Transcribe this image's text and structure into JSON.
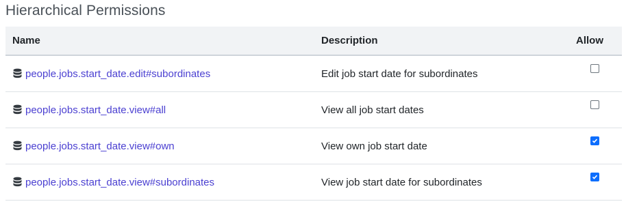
{
  "section": {
    "title": "Hierarchical Permissions"
  },
  "table": {
    "headers": {
      "name": "Name",
      "description": "Description",
      "allow": "Allow"
    },
    "rows": [
      {
        "icon": "database-icon",
        "name": "people.jobs.start_date.edit#subordinates",
        "description": "Edit job start date for subordinates",
        "allowed": false
      },
      {
        "icon": "database-icon",
        "name": "people.jobs.start_date.view#all",
        "description": "View all job start dates",
        "allowed": false
      },
      {
        "icon": "database-icon",
        "name": "people.jobs.start_date.view#own",
        "description": "View own job start date",
        "allowed": true
      },
      {
        "icon": "database-icon",
        "name": "people.jobs.start_date.view#subordinates",
        "description": "View job start date for subordinates",
        "allowed": true
      }
    ]
  },
  "colors": {
    "link": "#4a3fd1",
    "header_bg": "#f1f3f5",
    "checkbox_checked": "#0d6efd"
  }
}
